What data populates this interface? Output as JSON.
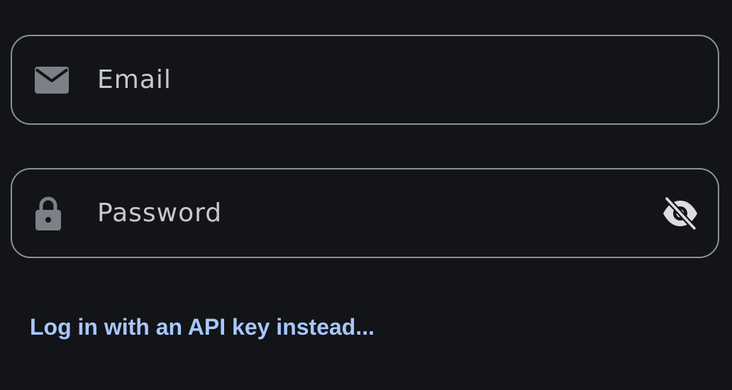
{
  "email_field": {
    "placeholder": "Email",
    "value": "",
    "icon": "mail-icon"
  },
  "password_field": {
    "placeholder": "Password",
    "value": "",
    "icon": "lock-icon",
    "toggle_icon": "eye-off-icon"
  },
  "api_key_link": {
    "label": "Log in with an API key instead..."
  },
  "colors": {
    "background": "#121418",
    "field_border": "#8d9096",
    "icon": "#7e8088",
    "toggle_icon": "#dcdde0",
    "text": "#c8c9cd",
    "link": "#a8c7fa"
  }
}
